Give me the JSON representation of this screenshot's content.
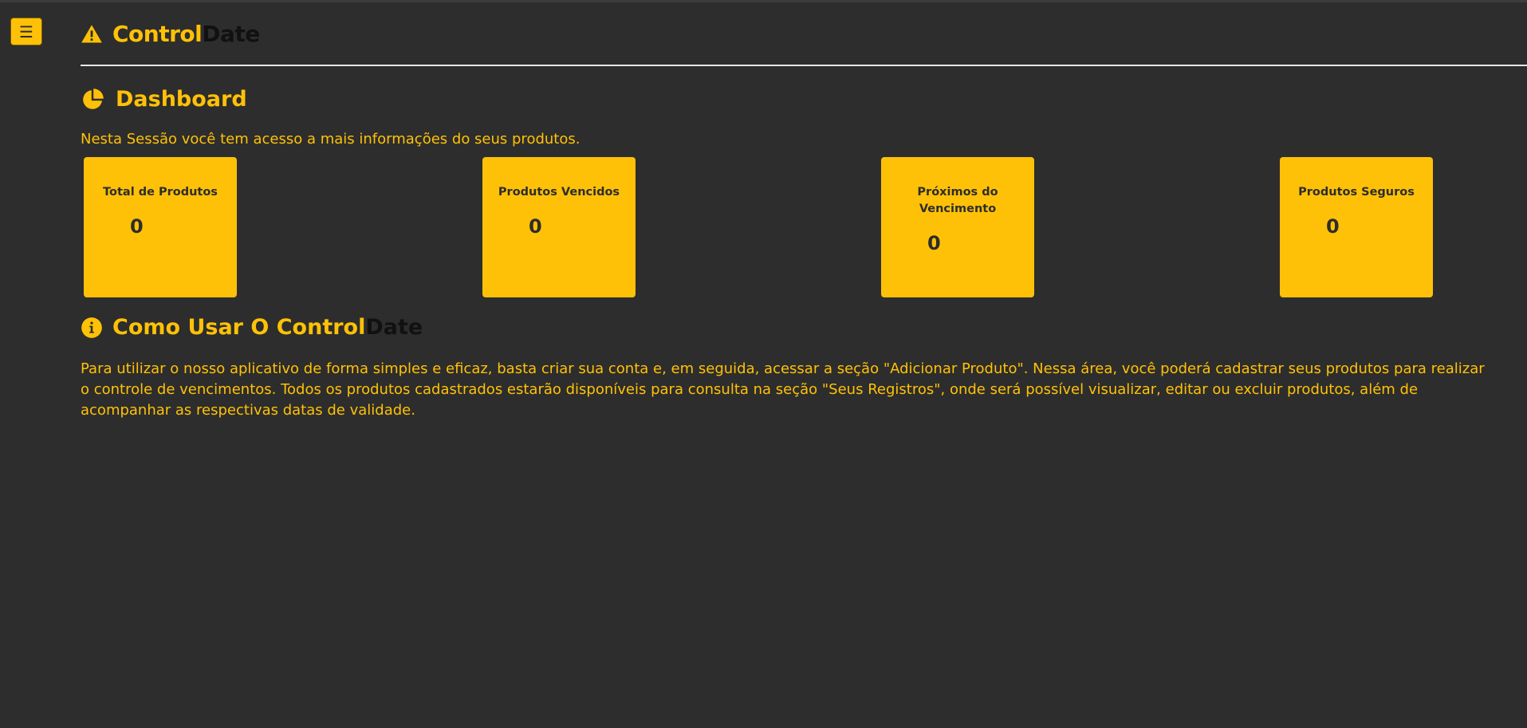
{
  "header": {
    "menu_icon": "hamburger-icon",
    "brand_icon": "warning-triangle-icon",
    "brand_part1": "Control",
    "brand_part2": "Date"
  },
  "dashboard": {
    "icon": "pie-chart-icon",
    "title": "Dashboard",
    "subtitle": "Nesta Sessão você tem acesso a mais informações do seus produtos."
  },
  "cards": [
    {
      "title": "Total de Produtos",
      "value": "0"
    },
    {
      "title": "Produtos Vencidos",
      "value": "0"
    },
    {
      "title": "Próximos do Vencimento",
      "value": "0"
    },
    {
      "title": "Produtos Seguros",
      "value": "0"
    }
  ],
  "how_to": {
    "icon": "info-circle-icon",
    "title_part1": "Como Usar O Control",
    "title_part2": "Date",
    "text": "Para utilizar o nosso aplicativo de forma simples e eficaz, basta criar sua conta e, em seguida, acessar a seção \"Adicionar Produto\". Nessa área, você poderá cadastrar seus produtos para realizar o controle de vencimentos. Todos os produtos cadastrados estarão disponíveis para consulta na seção \"Seus Registros\", onde será possível visualizar, editar ou excluir produtos, além de acompanhar as respectivas datas de validade."
  },
  "colors": {
    "background": "#2d2d2d",
    "accent": "#ffc107",
    "dark_text": "#111111"
  }
}
